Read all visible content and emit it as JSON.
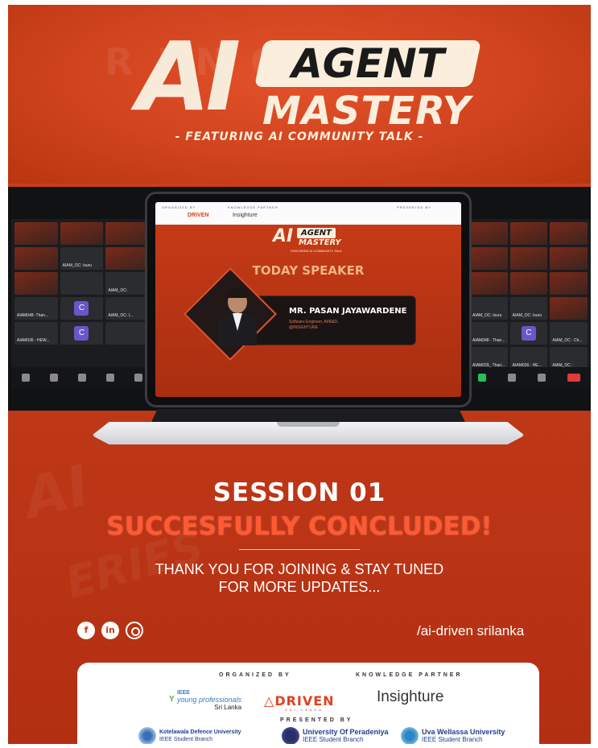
{
  "header": {
    "logo_ai": "AI",
    "logo_agent": "AGENT",
    "logo_mastery": "MASTERY",
    "tagline": "- FEATURING AI COMMUNITY TALK -"
  },
  "meeting_left": {
    "labels": [
      "AIAM048- Than...",
      "AIAM_OC: Isuru",
      "AIAM_OC:",
      "AIAM_OC: I...",
      "AIAM036 - HEW..."
    ],
    "avatar_letter": "C"
  },
  "meeting_right": {
    "labels": [
      "AIAM_OC: Isuru",
      "AIAM_OC: Isuru",
      "AIAM048 - Than...",
      "AIAM_OC : Ch...",
      "AIAM029_ Thari...",
      "AIAM036 - HE...",
      "AIAM_OC :"
    ],
    "avatar_letter": "C"
  },
  "slide": {
    "logo_ai": "AI",
    "logo_agent": "AGENT",
    "logo_mastery": "MASTERY",
    "feat": "FEATURING AI COMMUNITY TALK",
    "organized": "ORGANIZED BY",
    "knowledge": "KNOWLEDGE PARTNER",
    "presented": "PRESENTED BY",
    "driven": "DRIVEN",
    "insighture": "Insighture",
    "title": "TODAY SPEAKER",
    "speaker_name": "MR. PASAN JAYAWARDENE",
    "speaker_role": "Software Engineer, AI/R&D,",
    "speaker_org": "@INSIGHTURE"
  },
  "body": {
    "session": "SESSION 01",
    "concluded": "SUCCESFULLY CONCLUDED!",
    "thanks_line1": "THANK YOU FOR JOINING & STAY TUNED",
    "thanks_line2": "FOR MORE UPDATES...",
    "handle": "/ai-driven srilanka"
  },
  "socials": {
    "facebook": "f",
    "linkedin": "in",
    "instagram": ""
  },
  "partners": {
    "organized_by": "ORGANIZED BY",
    "knowledge_partner": "KNOWLEDGE PARTNER",
    "presented_by": "PRESENTED BY",
    "ieee_top": "IEEE",
    "ieee_mid": "young professionals",
    "ieee_bottom": "Sri Lanka",
    "driven": "DRIVEN",
    "driven_sub": "SRI LANKA",
    "insighture": "Insighture",
    "kdu_name": "Kotelawala Defence University",
    "kdu_branch": "IEEE Student Branch",
    "pera_name": "University Of Peradeniya",
    "pera_branch": "IEEE Student Branch",
    "uwu_name": "Uva Wellassa University",
    "uwu_branch": "IEEE Student Branch"
  },
  "colors": {
    "brand_red": "#cf431e",
    "accent_orange": "#ff5a33",
    "cream": "#fbeedc",
    "speaker_accent": "#f1b487"
  }
}
